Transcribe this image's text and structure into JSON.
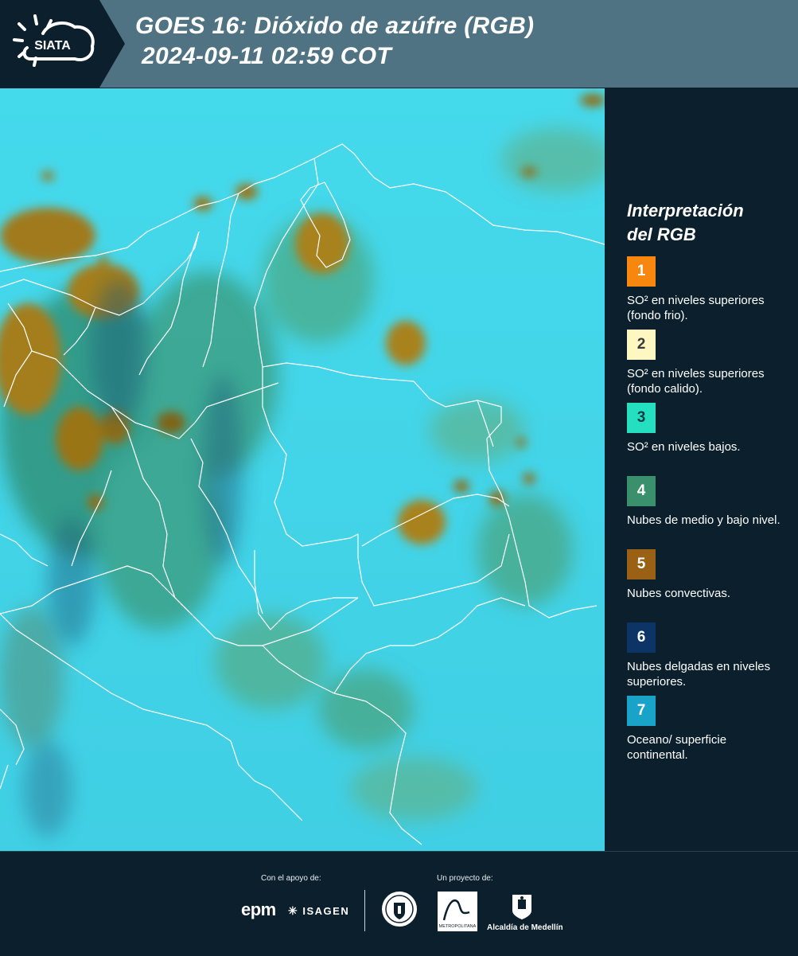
{
  "header": {
    "logo_text": "SIATA",
    "title_line1": "GOES 16: Dióxido de azúfre (RGB)",
    "title_line2": "2024-09-11 02:59 COT"
  },
  "legend": {
    "title_line1": "Interpretación",
    "title_line2": "del RGB",
    "items": [
      {
        "number": "1",
        "label": "SO² en niveles superiores (fondo frio).",
        "color": "#f7870f",
        "text_color": "#ffffff"
      },
      {
        "number": "2",
        "label": "SO² en niveles superiores (fondo calido).",
        "color": "#fff7c2",
        "text_color": "#3a3a3a"
      },
      {
        "number": "3",
        "label": "SO² en niveles bajos.",
        "color": "#25e0c0",
        "text_color": "#0c3f45"
      },
      {
        "number": "4",
        "label": "Nubes de medio y bajo nivel.",
        "color": "#3a8f6c",
        "text_color": "#ffffff"
      },
      {
        "number": "5",
        "label": "Nubes convectivas.",
        "color": "#9a6014",
        "text_color": "#ffffff"
      },
      {
        "number": "6",
        "label": "Nubes delgadas en niveles superiores.",
        "color": "#0c3466",
        "text_color": "#ffffff"
      },
      {
        "number": "7",
        "label": "Oceano/ superficie continental.",
        "color": "#1aa3c8",
        "text_color": "#ffffff"
      }
    ]
  },
  "footer": {
    "support_label": "Con el apoyo de:",
    "project_label": "Un proyecto de:",
    "epm_text": "epm",
    "isagen_text": "ISAGEN",
    "area_text": "METROPOLITANA",
    "alcaldia_text": "Alcaldía de Medellín"
  }
}
